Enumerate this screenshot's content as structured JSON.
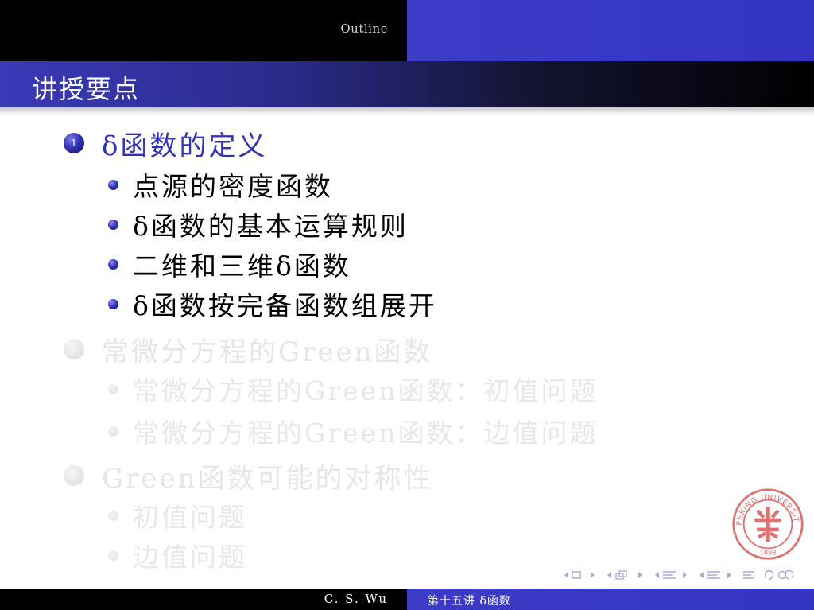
{
  "headline": {
    "section": "Outline"
  },
  "frame": {
    "title": "讲授要点"
  },
  "sections": [
    {
      "number": "1",
      "title": "δ函数的定义",
      "items": [
        "点源的密度函数",
        "δ函数的基本运算规则",
        "二维和三维δ函数",
        "δ函数按完备函数组展开"
      ]
    },
    {
      "number": "2",
      "title": "常微分方程的Green函数",
      "items": [
        "常微分方程的Green函数：初值问题",
        "常微分方程的Green函数：边值问题"
      ]
    },
    {
      "number": "3",
      "title": "Green函数可能的对称性",
      "items": [
        "初值问题",
        "边值问题"
      ]
    }
  ],
  "footer": {
    "author": "C. S. Wu",
    "title": "第十五讲  δ函数"
  },
  "seal": {
    "year": "1898",
    "text": "PEKING UNIVERSITY",
    "icon": "peking-university-seal"
  },
  "colors": {
    "accent": "#3333b3",
    "dim": "#e6e6e6",
    "seal": "#e06464"
  }
}
